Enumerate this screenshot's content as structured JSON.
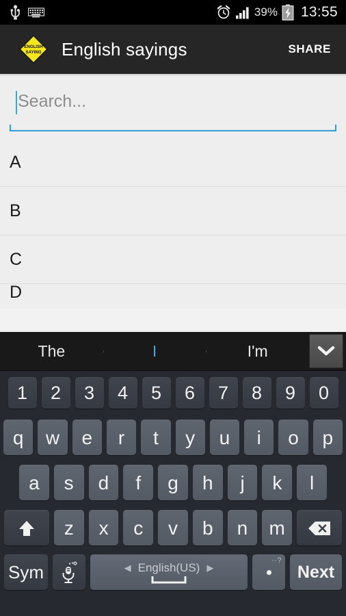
{
  "statusbar": {
    "left_icons": [
      "usb-icon",
      "keyboard-icon"
    ],
    "right_icons": [
      "alarm-clock-icon",
      "signal-bars-icon",
      "battery-charging-icon"
    ],
    "battery_percent": "39%",
    "time": "13:55"
  },
  "actionbar": {
    "app_icon": "english-sayings-diamond-logo",
    "logo_line1": "ENGLISH",
    "logo_line2": "SAYING",
    "title": "English sayings",
    "share_label": "SHARE"
  },
  "search": {
    "placeholder": "Search...",
    "value": "",
    "accent_color": "#2e9fd6"
  },
  "list": {
    "items": [
      {
        "label": "A"
      },
      {
        "label": "B"
      },
      {
        "label": "C"
      },
      {
        "label": "D"
      }
    ]
  },
  "keyboard": {
    "suggestions": [
      {
        "text": "The",
        "active": false
      },
      {
        "text": "I",
        "active": true
      },
      {
        "text": "I'm",
        "active": false
      }
    ],
    "toggle_icon": "chevron-down-icon",
    "row_numbers": [
      "1",
      "2",
      "3",
      "4",
      "5",
      "6",
      "7",
      "8",
      "9",
      "0"
    ],
    "row_top": [
      "q",
      "w",
      "e",
      "r",
      "t",
      "y",
      "u",
      "i",
      "o",
      "p"
    ],
    "row_home": [
      "a",
      "s",
      "d",
      "f",
      "g",
      "h",
      "j",
      "k",
      "l"
    ],
    "row_bottom": [
      "z",
      "x",
      "c",
      "v",
      "b",
      "n",
      "m"
    ],
    "shift_icon": "shift-arrow-up-icon",
    "backspace_icon": "backspace-delete-icon",
    "sym_label": "Sym",
    "mic_icon": "microphone-settings-icon",
    "space_language": "English(US)",
    "space_arrow_left": "◀",
    "space_arrow_right": "▶",
    "period_label": ".",
    "period_marks": "··?",
    "next_label": "Next"
  }
}
